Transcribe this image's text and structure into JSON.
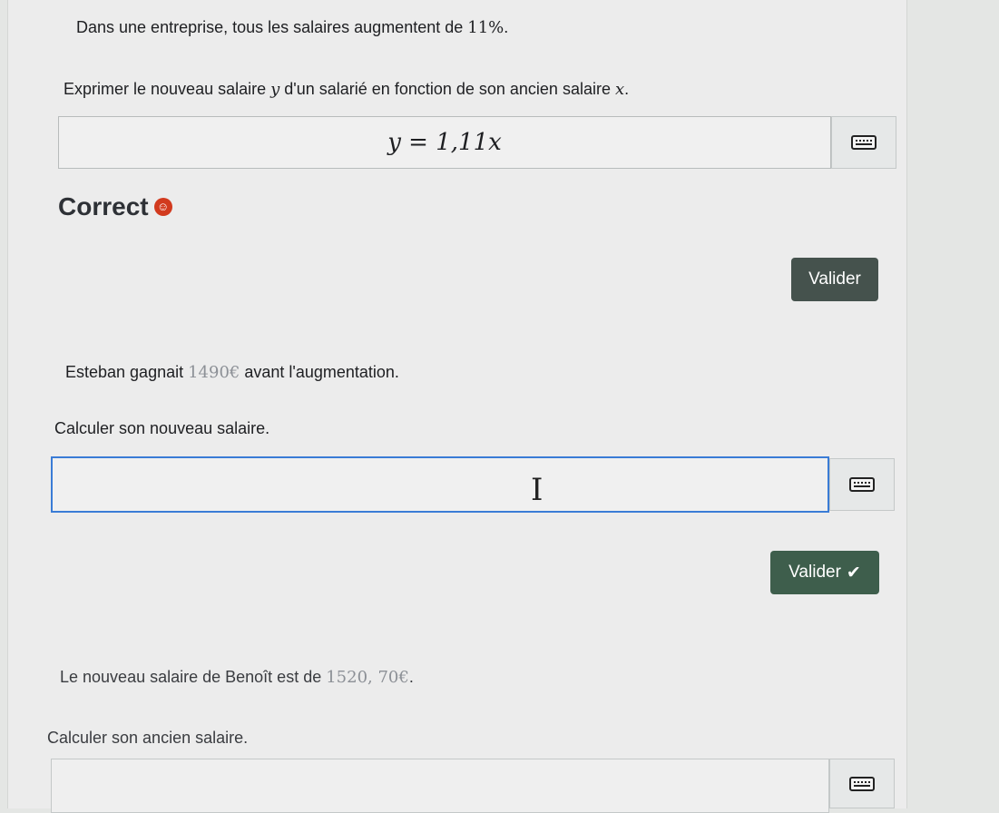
{
  "exercise1": {
    "statement_pre": "Dans une entreprise, tous les salaires augmentent de ",
    "statement_pct": "11%",
    "statement_post": ".",
    "prompt_pre": "Exprimer le nouveau salaire ",
    "var_y": "y",
    "prompt_mid": " d'un salarié en fonction de son ancien salaire ",
    "var_x": "x",
    "prompt_post": ".",
    "answer": "y = 1,11x",
    "feedback": "Correct",
    "feedback_icon": "smiley-icon",
    "validate_label": "Valider"
  },
  "exercise2": {
    "statement_pre": "Esteban gagnait ",
    "amount": "1490€",
    "statement_post": " avant l'augmentation.",
    "prompt": "Calculer son nouveau salaire.",
    "input_value": "",
    "validate_label": "Valider",
    "validate_icon": "check-icon"
  },
  "exercise3": {
    "statement_pre": "Le nouveau salaire de Benoît est de ",
    "amount": "1520, 70€",
    "statement_post": ".",
    "prompt": "Calculer son ancien salaire.",
    "input_value": ""
  },
  "icons": {
    "keyboard": "keyboard-icon"
  },
  "colors": {
    "button_dark": "#45524d",
    "button_green": "#3e5e4c",
    "input_focus_border": "#3a7cd6",
    "feedback_icon": "#d23a1e"
  }
}
